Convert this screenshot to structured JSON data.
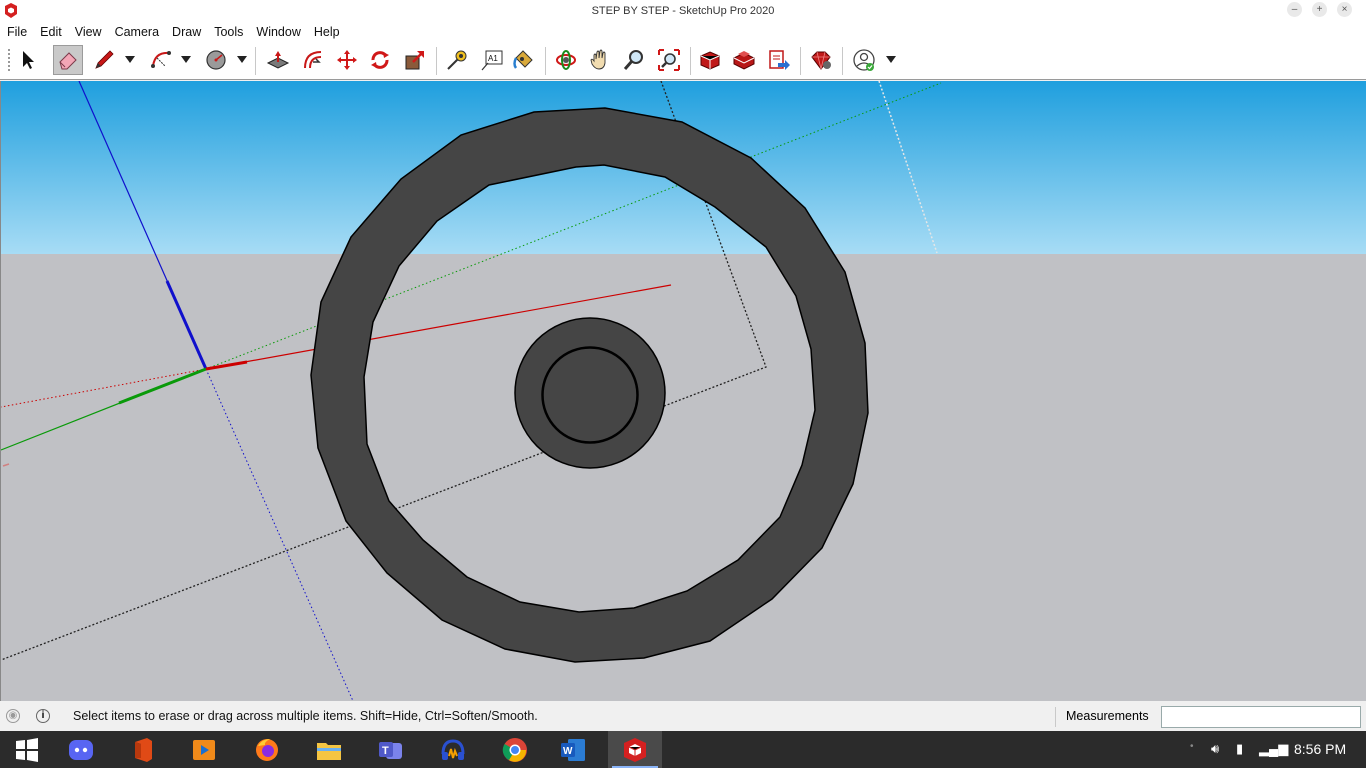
{
  "window": {
    "title": "STEP BY STEP - SketchUp Pro 2020",
    "controls": [
      "minimize",
      "maximize",
      "close"
    ]
  },
  "menu": [
    "File",
    "Edit",
    "View",
    "Camera",
    "Draw",
    "Tools",
    "Window",
    "Help"
  ],
  "toolbar": {
    "tools": [
      {
        "name": "select-tool-icon"
      },
      {
        "name": "eraser-tool-icon",
        "active": true
      },
      {
        "name": "line-tool-icon"
      },
      {
        "name": "arc-tool-icon"
      },
      {
        "name": "shape-tool-icon"
      },
      {
        "name": "push-pull-tool-icon"
      },
      {
        "name": "offset-tool-icon"
      },
      {
        "name": "move-tool-icon"
      },
      {
        "name": "rotate-tool-icon"
      },
      {
        "name": "scale-tool-icon"
      },
      {
        "name": "tape-measure-tool-icon"
      },
      {
        "name": "text-tool-icon"
      },
      {
        "name": "paint-bucket-tool-icon"
      },
      {
        "name": "orbit-tool-icon"
      },
      {
        "name": "pan-tool-icon"
      },
      {
        "name": "zoom-tool-icon"
      },
      {
        "name": "zoom-extents-tool-icon"
      },
      {
        "name": "3d-warehouse-icon"
      },
      {
        "name": "extension-warehouse-icon"
      },
      {
        "name": "layout-send-icon"
      },
      {
        "name": "extension-manager-icon"
      },
      {
        "name": "account-icon"
      }
    ],
    "text_tool_label": "A1"
  },
  "colors": {
    "sky_top": "#1f9fde",
    "sky_bottom": "#a7dcf5",
    "ground": "#c0c1c5",
    "model_fill": "#454545",
    "axis_red": "#cc0000",
    "axis_green": "#0a9a0a",
    "axis_blue": "#1010cc",
    "taskbar": "#2b2b2b"
  },
  "status": {
    "hint": "Select items to erase or drag across multiple items. Shift=Hide, Ctrl=Soften/Smooth.",
    "measurements_label": "Measurements",
    "measurements_value": ""
  },
  "taskbar": {
    "apps": [
      "windows-start-icon",
      "discord-icon",
      "office-icon",
      "media-player-icon",
      "firefox-icon",
      "file-explorer-icon",
      "teams-icon",
      "audio-app-icon",
      "chrome-icon",
      "word-icon",
      "sketchup-icon"
    ],
    "active_app": "sketchup-icon",
    "clock": "8:56 PM"
  }
}
